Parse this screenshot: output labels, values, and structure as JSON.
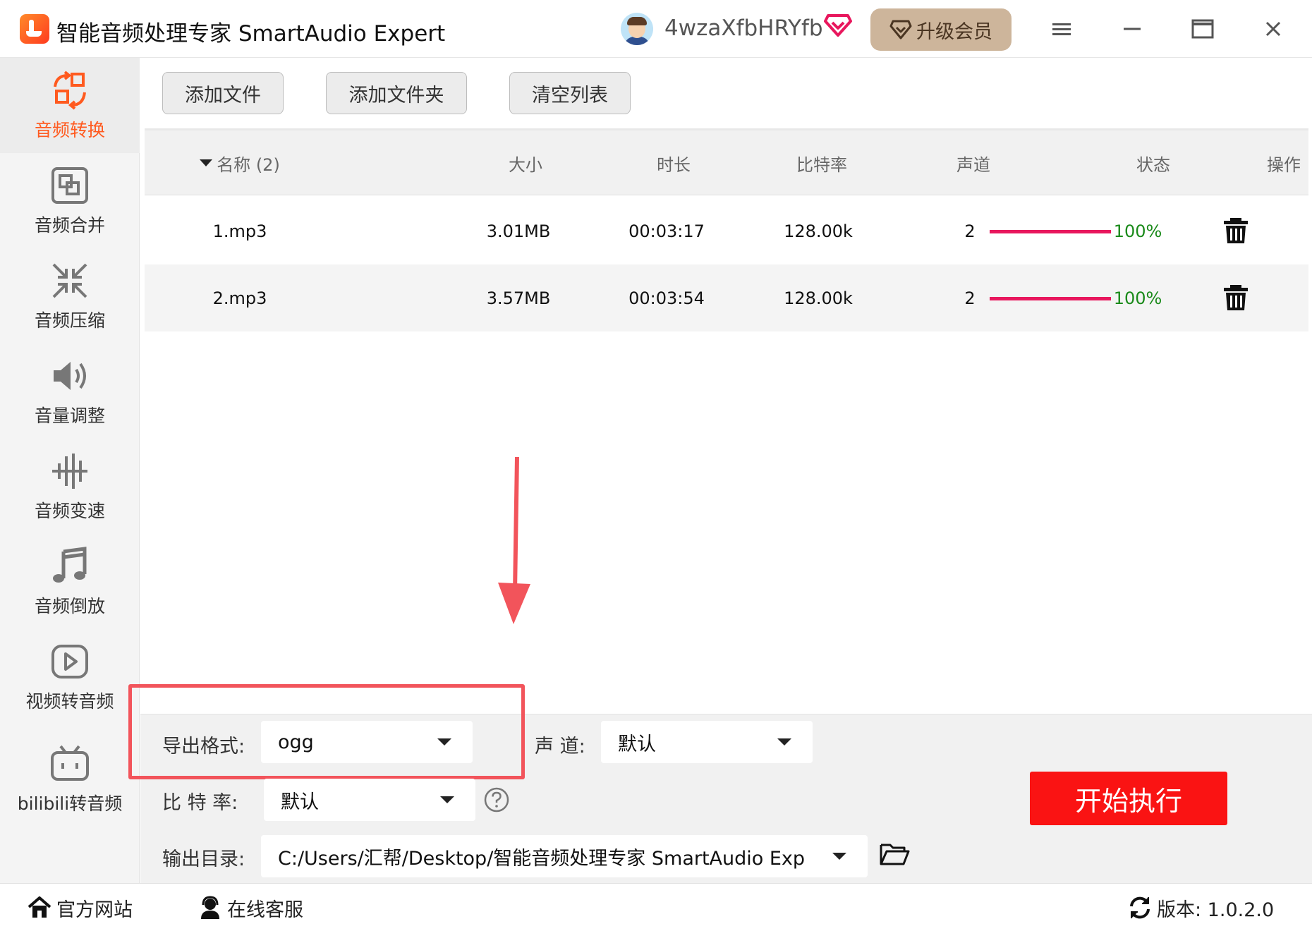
{
  "app": {
    "title": "智能音频处理专家 SmartAudio Expert"
  },
  "user": {
    "name": "4wzaXfbHRYfb",
    "upgrade_label": "升级会员"
  },
  "sidebar": {
    "items": [
      {
        "label": "音频转换",
        "icon": "convert-icon",
        "active": true
      },
      {
        "label": "音频合并",
        "icon": "merge-icon"
      },
      {
        "label": "音频压缩",
        "icon": "compress-icon"
      },
      {
        "label": "音量调整",
        "icon": "volume-icon"
      },
      {
        "label": "音频变速",
        "icon": "speed-icon"
      },
      {
        "label": "音频倒放",
        "icon": "music-note-icon"
      },
      {
        "label": "视频转音频",
        "icon": "play-icon"
      },
      {
        "label": "bilibili转音频",
        "icon": "tv-icon"
      }
    ]
  },
  "toolbar": {
    "add_file": "添加文件",
    "add_folder": "添加文件夹",
    "clear_list": "清空列表"
  },
  "table": {
    "columns": {
      "name": "名称 (2)",
      "size": "大小",
      "duration": "时长",
      "bitrate": "比特率",
      "channels": "声道",
      "status": "状态",
      "actions": "操作"
    },
    "rows": [
      {
        "name": "1.mp3",
        "size": "3.01MB",
        "duration": "00:03:17",
        "bitrate": "128.00k",
        "channels": "2",
        "progress": 100,
        "status": "100%"
      },
      {
        "name": "2.mp3",
        "size": "3.57MB",
        "duration": "00:03:54",
        "bitrate": "128.00k",
        "channels": "2",
        "progress": 100,
        "status": "100%"
      }
    ]
  },
  "settings": {
    "format_label": "导出格式:",
    "format_value": "ogg",
    "channel_label": "声 道:",
    "channel_value": "默认",
    "bitrate_label": "比 特 率:",
    "bitrate_value": "默认",
    "output_label": "输出目录:",
    "output_value": "C:/Users/汇帮/Desktop/智能音频处理专家 SmartAudio Exp",
    "start_label": "开始执行"
  },
  "statusbar": {
    "website": "官方网站",
    "support": "在线客服",
    "version": "版本: 1.0.2.0"
  },
  "colors": {
    "accent": "#ff5a1f",
    "progress": "#e8175d",
    "start": "#fa1313",
    "highlight": "#f2545b"
  }
}
